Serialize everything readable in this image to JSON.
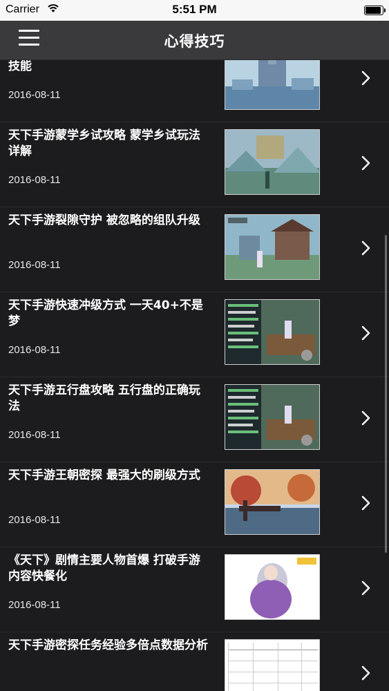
{
  "status_bar": {
    "carrier": "Carrier",
    "time": "5:51 PM",
    "battery_level": 1.0
  },
  "nav": {
    "title": "心得技巧"
  },
  "articles": [
    {
      "title": "天下手游奕剑技能详解 奕剑都有哪些技能",
      "date": "2016-08-11",
      "thumb_icon": "castle-game-screenshot"
    },
    {
      "title": "天下手游蒙学乡试攻略 蒙学乡试玩法详解",
      "date": "2016-08-11",
      "thumb_icon": "landscape-game-screenshot"
    },
    {
      "title": "天下手游裂隙守护 被忽略的组队升级",
      "date": "2016-08-11",
      "thumb_icon": "temple-game-screenshot"
    },
    {
      "title": "天下手游快速冲级方式 一天40+不是梦",
      "date": "2016-08-11",
      "thumb_icon": "gameplay-ui-screenshot"
    },
    {
      "title": "天下手游五行盘攻略 五行盘的正确玩法",
      "date": "2016-08-11",
      "thumb_icon": "gameplay-ui-screenshot"
    },
    {
      "title": "天下手游王朝密探 最强大的刷级方式",
      "date": "2016-08-11",
      "thumb_icon": "bridge-autumn-screenshot"
    },
    {
      "title": "《天下》剧情主要人物首爆 打破手游内容快餐化",
      "date": "2016-08-11",
      "thumb_icon": "character-art"
    },
    {
      "title": "天下手游密探任务经验多倍点数据分析",
      "date": "",
      "thumb_icon": "data-table-image"
    }
  ]
}
